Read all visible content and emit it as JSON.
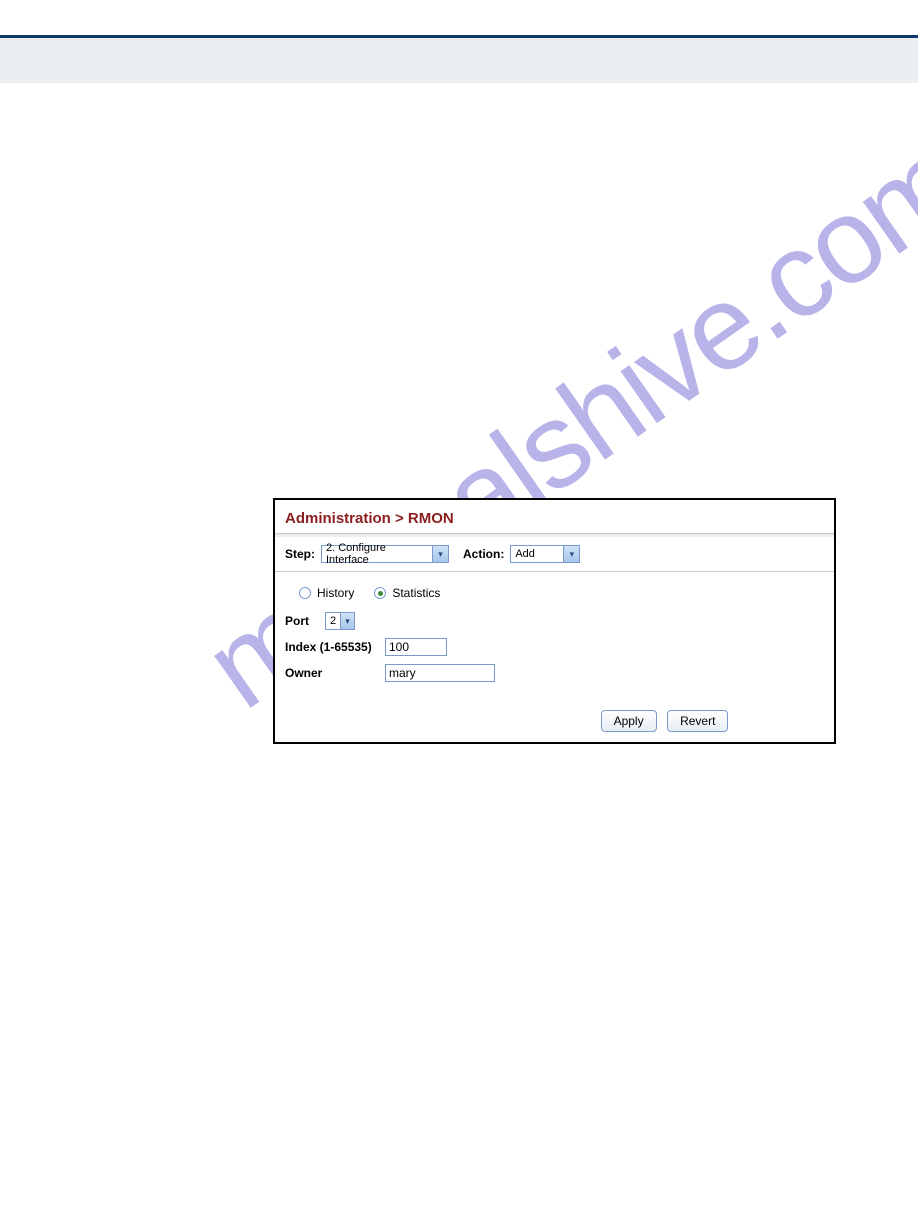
{
  "watermark": "manualshive.com",
  "panel": {
    "title": "Administration > RMON",
    "step_label": "Step:",
    "step_value": "2. Configure Interface",
    "action_label": "Action:",
    "action_value": "Add",
    "radio_history": "History",
    "radio_statistics": "Statistics",
    "port_label": "Port",
    "port_value": "2",
    "index_label": "Index (1-65535)",
    "index_value": "100",
    "owner_label": "Owner",
    "owner_value": "mary",
    "apply_label": "Apply",
    "revert_label": "Revert"
  }
}
